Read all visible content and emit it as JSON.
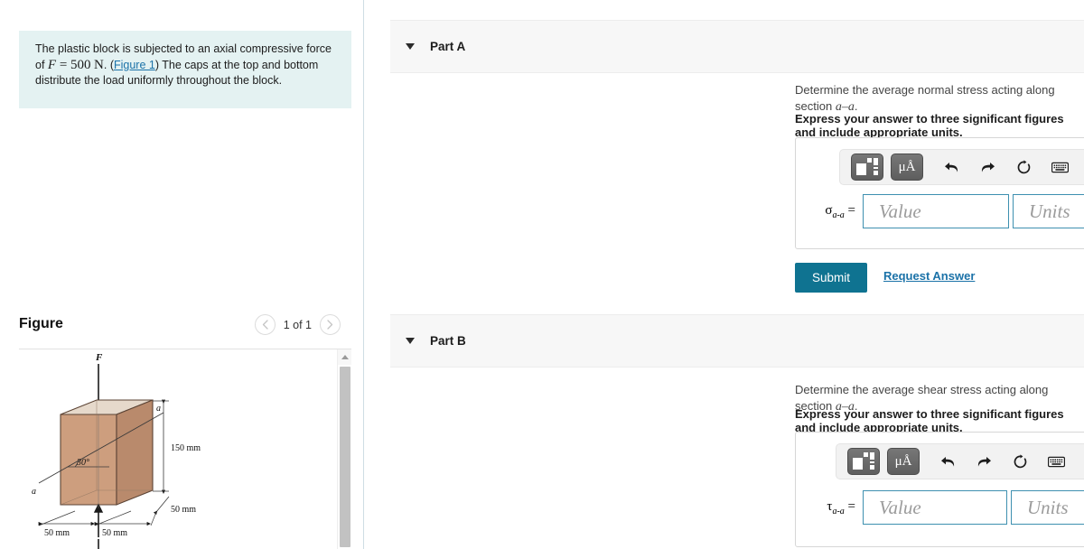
{
  "problem": {
    "text_before_f": "The plastic block is subjected to an axial compressive force of ",
    "force_symbol": "F",
    "equals": " = ",
    "force_value": "500",
    "force_unit": "N",
    "text_after_unit": ". (",
    "figure_link": "Figure 1",
    "text_after_link": ") The caps at the top and bottom distribute the load uniformly throughout the block."
  },
  "figure": {
    "title": "Figure",
    "counter": "1 of 1",
    "prev_icon": "chevron-left-icon",
    "next_icon": "chevron-right-icon",
    "diagram": {
      "force_label": "F",
      "section_label_top": "a",
      "section_label_bottom": "a",
      "angle_label": "30°",
      "height_label": "150 mm",
      "depth_label": "50 mm",
      "width_label_left": "50 mm",
      "width_label_right": "50 mm",
      "colors": {
        "top_face": "#e6d9cb",
        "front_face": "#cd9e7e",
        "side_face": "#b98a6c",
        "outline": "#5b4334"
      }
    },
    "scrollbar": {
      "up_icon": "scroll-up-arrow-icon"
    }
  },
  "parts": [
    {
      "id": "part-a",
      "label": "Part A",
      "question_prefix": "Determine the average normal stress acting along section ",
      "question_section": "a–a",
      "question_suffix": ".",
      "instruction": "Express your answer to three significant figures and include appropriate units.",
      "answer": {
        "symbol": "σ",
        "subscript": "a-a",
        "equals": "=",
        "value_placeholder": "Value",
        "units_placeholder": "Units"
      },
      "toolbar": {
        "template_icon": "math-template-icon",
        "units_label": "μÅ",
        "undo_icon": "undo-icon",
        "redo_icon": "redo-icon",
        "reset_icon": "reset-icon",
        "keyboard_icon": "keyboard-icon",
        "help_icon": "?"
      },
      "submit_label": "Submit",
      "request_answer_label": "Request Answer",
      "has_submit": true
    },
    {
      "id": "part-b",
      "label": "Part B",
      "question_prefix": "Determine the average shear stress acting along section ",
      "question_section": "a–a",
      "question_suffix": ".",
      "instruction": "Express your answer to three significant figures and include appropriate units.",
      "answer": {
        "symbol": "τ",
        "subscript": "a-a",
        "equals": "=",
        "value_placeholder": "Value",
        "units_placeholder": "Units"
      },
      "toolbar": {
        "template_icon": "math-template-icon",
        "units_label": "μÅ",
        "undo_icon": "undo-icon",
        "redo_icon": "redo-icon",
        "reset_icon": "reset-icon",
        "keyboard_icon": "keyboard-icon",
        "help_icon": "?"
      },
      "has_submit": false
    }
  ],
  "colors": {
    "accent": "#0f7391",
    "link": "#1b72a8",
    "problem_bg": "#e4f2f2",
    "header_bg": "#f7f7f7",
    "input_border": "#3e90b0"
  }
}
